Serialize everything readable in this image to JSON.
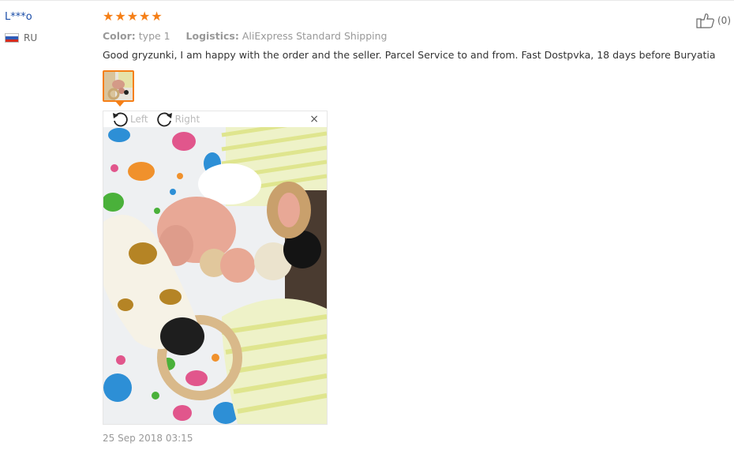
{
  "review": {
    "user": {
      "name": "L***o",
      "country": "RU"
    },
    "rating": {
      "stars": 5,
      "max": 5
    },
    "meta": {
      "color_label": "Color:",
      "color_value": "type 1",
      "logistics_label": "Logistics:",
      "logistics_value": "AliExpress Standard Shipping"
    },
    "text": "Good gryzunki, I am happy with the order and the seller. Parcel Service to and from. Fast Dostpvka, 18 days before Buryatia",
    "likes": "(0)",
    "date": "25 Sep 2018 03:15"
  },
  "viewer": {
    "rotate_left_label": "Left",
    "rotate_right_label": "Right",
    "close_symbol": "×"
  },
  "icons": [
    "russia-flag-icon",
    "star-icon",
    "rotate-left-icon",
    "rotate-right-icon",
    "close-icon",
    "thumbs-up-icon"
  ],
  "colors": {
    "accent": "#f57f17",
    "username": "#1a4da8",
    "muted": "#999999"
  }
}
